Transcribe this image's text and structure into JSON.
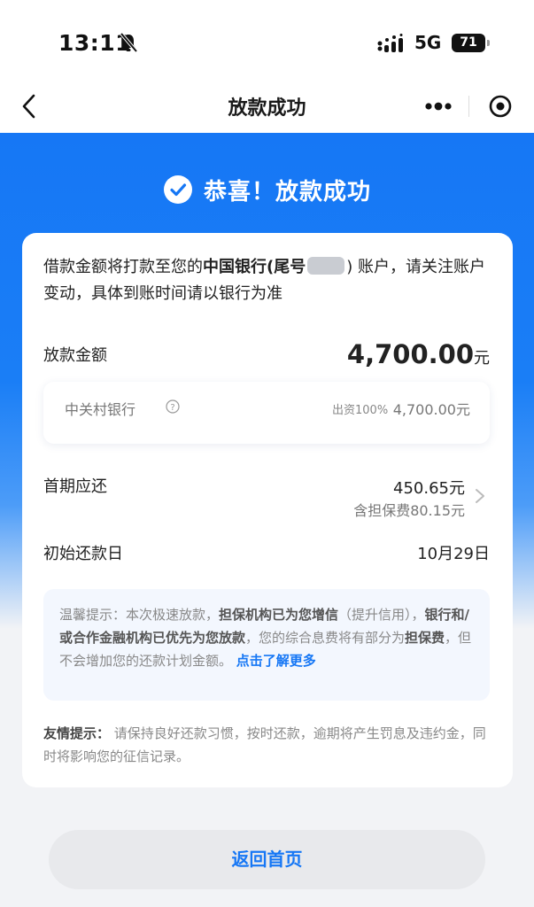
{
  "status_bar": {
    "time": "13:11",
    "network": "5G",
    "battery": "71"
  },
  "nav": {
    "title": "放款成功"
  },
  "hero": {
    "title": "恭喜！放款成功",
    "accent_color": "#1677f5"
  },
  "notice": {
    "prefix": "借款金额将打款至您的",
    "bank": "中国银行(尾号",
    "suffix": ") 账户，请关注账户变动，具体到账时间请以银行为准"
  },
  "loan": {
    "label": "放款金额",
    "amount": "4,700.00",
    "unit": "元"
  },
  "lender": {
    "name": "中关村银行",
    "ratio": "出资100%",
    "amount": "4,700.00元"
  },
  "first_payment": {
    "label": "首期应还",
    "amount": "450.65元",
    "fee": "含担保费80.15元"
  },
  "start_date": {
    "label": "初始还款日",
    "value": "10月29日"
  },
  "warm_tip": {
    "part1": "温馨提示：本次极速放款，",
    "bold1": "担保机构已为您增信",
    "part2": "（提升信用），",
    "bold2": "银行和/或合作金融机构已优先为您放款",
    "part3": "，您的综合息费将有部分为",
    "bold3": "担保费",
    "part4": "，但不会增加您的还款计划金额。",
    "link": "点击了解更多"
  },
  "friendly_tip": {
    "label": "友情提示：",
    "text": "请保持良好还款习惯，按时还款，逾期将产生罚息及违约金，同时将影响您的征信记录。"
  },
  "footer": {
    "home_button": "返回首页"
  }
}
